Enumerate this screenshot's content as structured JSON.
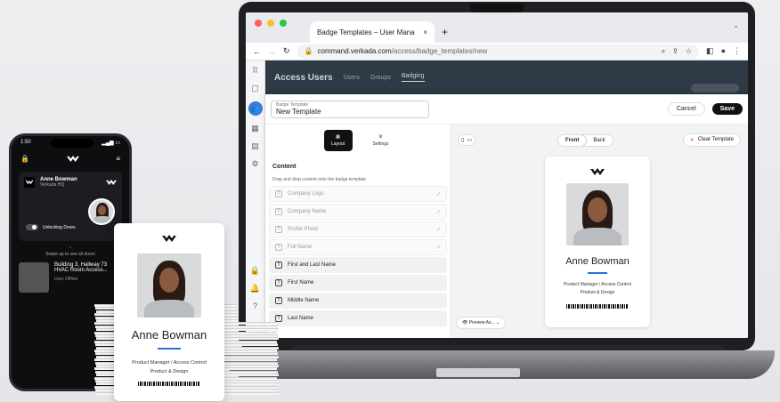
{
  "browser": {
    "tab_title": "Badge Templates – User Mana",
    "tab_close": "×",
    "new_tab": "+",
    "url_host": "command.verkada.com",
    "url_path": "/access/badge_templates/new",
    "chevron": "⌄"
  },
  "app": {
    "header_title": "Access Users",
    "header_tabs": [
      "Users",
      "Groups",
      "Badging"
    ],
    "modal": {
      "field_label": "Badge Template",
      "field_value": "New Template",
      "cancel_label": "Cancel",
      "save_label": "Save"
    },
    "left": {
      "tab_layout": "Layout",
      "tab_settings": "Settings",
      "section_title": "Content",
      "section_hint": "Drag and drop content onto the badge template",
      "items": [
        {
          "label": "Company Logo",
          "added": true
        },
        {
          "label": "Company Name",
          "added": true
        },
        {
          "label": "Profile Photo",
          "added": true
        },
        {
          "label": "Full Name",
          "added": true
        },
        {
          "label": "First and Last Name",
          "added": false
        },
        {
          "label": "First Name",
          "added": false
        },
        {
          "label": "Middle Name",
          "added": false
        },
        {
          "label": "Last Name",
          "added": false
        }
      ]
    },
    "right": {
      "front_label": "Front",
      "back_label": "Back",
      "clear_label": "Clear Template",
      "preview_label": "Preview As...",
      "card_name": "Anne Bowman",
      "card_role_line1": "Product Manager / Access Control",
      "card_role_line2": "Product & Design"
    }
  },
  "phone": {
    "time": "1:50",
    "user_name": "Anne Bowman",
    "user_org": "Verkada HQ",
    "toggle_label": "Unlocking Doors",
    "swipe_hint": "Swipe up to see all doors",
    "door_name_line1": "Building 3, Hallway 73",
    "door_name_line2": "HVAC Room Access...",
    "door_status": "User Offline"
  },
  "badge": {
    "name": "Anne Bowman",
    "role_line1": "Product Manager / Access Control",
    "role_line2": "Product & Design"
  },
  "colors": {
    "accent": "#2b6fd6",
    "save": "#111111",
    "darkbar": "#2e3a46"
  }
}
